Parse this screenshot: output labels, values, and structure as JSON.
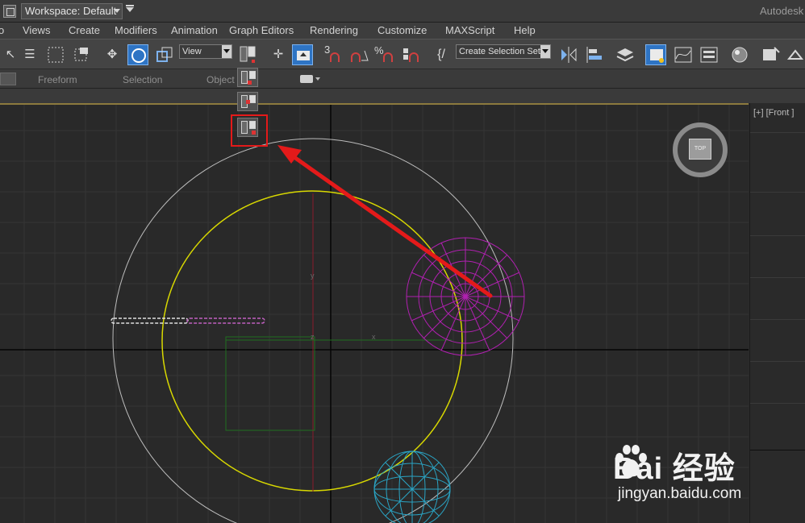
{
  "title_bar": {
    "workspace_label": "Workspace: Default",
    "brand": "Autodesk"
  },
  "menu": {
    "items": [
      "o",
      "Views",
      "Create",
      "Modifiers",
      "Animation",
      "Graph Editors",
      "Rendering",
      "Customize",
      "MAXScript",
      "Help"
    ]
  },
  "toolbar": {
    "reference_coord": "View",
    "selection_set_placeholder": "Create Selection Set",
    "snap_3_label": "3",
    "icons": [
      "select-icon",
      "select-by-name-icon",
      "rect-region-icon",
      "window-crossing-icon",
      "move-icon",
      "rotate-icon",
      "scale-icon",
      "pivot-icon",
      "manipulate-icon",
      "keyboard-shortcut-icon",
      "snap-icon",
      "angle-snap-icon",
      "percent-snap-icon",
      "spinner-snap-icon",
      "edit-named-sets-icon",
      "mirror-icon",
      "align-icon",
      "layer-icon",
      "scene-explorer-icon",
      "curve-editor-icon",
      "schematic-icon",
      "material-editor-icon",
      "render-setup-icon",
      "render-frame-icon"
    ]
  },
  "ribbon": {
    "tabs": [
      "Freeform",
      "Selection",
      "Object"
    ]
  },
  "viewport": {
    "right_label": "[+] [Front ]",
    "nav_cube_label": "TOP",
    "axis_labels": {
      "y": "y",
      "x": "x",
      "z": "z"
    }
  },
  "watermark": {
    "brand": "Bai 经验",
    "url": "jingyan.baidu.com"
  },
  "colors": {
    "highlight": "#e41a1a",
    "accent": "#2e74c4",
    "circle": "#d8d800",
    "sphere_pink": "#b020b0",
    "sphere_cyan": "#2aa4c4"
  }
}
